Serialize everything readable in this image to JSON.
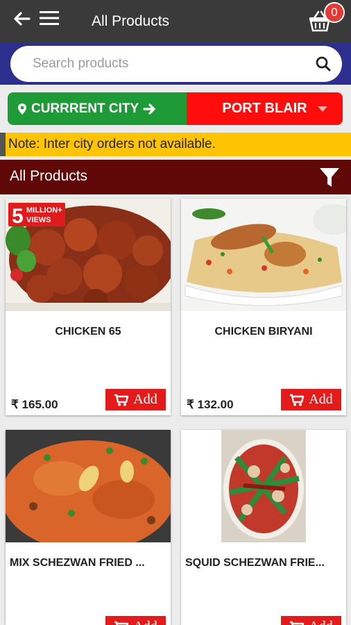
{
  "header": {
    "title": "All Products",
    "cart_count": "0"
  },
  "search": {
    "placeholder": "Search products"
  },
  "city": {
    "label": "CURRRENT CITY",
    "selected": "PORT BLAIR"
  },
  "note": "Note: Inter city orders not available.",
  "section": {
    "title": "All Products"
  },
  "products": [
    {
      "name": "CHICKEN 65",
      "price": "₹ 165.00",
      "add_label": "Add",
      "badge_top": "5",
      "badge_mid": "MILLION+",
      "badge_bot": "VIEWS"
    },
    {
      "name": "CHICKEN BIRYANI",
      "price": "₹ 132.00",
      "add_label": "Add"
    },
    {
      "name": "MIX SCHEZWAN FRIED ...",
      "price": "",
      "add_label": "Add"
    },
    {
      "name": "SQUID SCHEZWAN FRIE...",
      "price": "",
      "add_label": "Add"
    }
  ],
  "colors": {
    "topbar": "#3a3a3a",
    "searchbar": "#2d2f8f",
    "city_left": "#1e9b37",
    "city_right": "#ff0d0d",
    "note": "#ffc400",
    "section": "#600707",
    "add_button": "#e31b1b"
  }
}
